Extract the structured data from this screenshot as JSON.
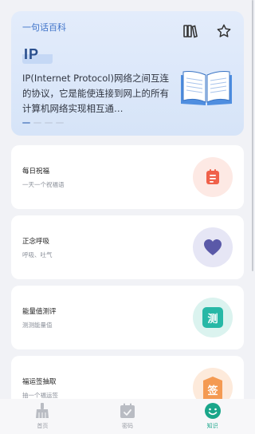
{
  "hero": {
    "subtitle": "一句话百科",
    "term": "IP",
    "description": "IP(Internet Protocol)网络之间互连的协议，它是能使连接到网上的所有计算机网络实现相互通…",
    "icons": [
      "bookshelf-icon",
      "star-icon"
    ]
  },
  "cards": [
    {
      "title": "每日祝福",
      "subtitle": "一天一个祝福语",
      "icon": "note-icon",
      "color": "#f0614a",
      "bg": "#fde9e4"
    },
    {
      "title": "正念呼吸",
      "subtitle": "呼吸、吐气",
      "icon": "heart-icon",
      "color": "#5a59a8",
      "bg": "#e6e6f5"
    },
    {
      "title": "能量值测评",
      "subtitle": "测测能量值",
      "icon_text": "测",
      "color": "#27b8a6",
      "bg": "#dbf3ef"
    },
    {
      "title": "福运签抽取",
      "subtitle": "抽一个福运签",
      "icon_text": "签",
      "color": "#f49a52",
      "bg": "#fdeadb"
    }
  ],
  "nav": [
    {
      "label": "首页",
      "icon": "broom-icon",
      "active": false
    },
    {
      "label": "密码",
      "icon": "calendar-check-icon",
      "active": false
    },
    {
      "label": "知识",
      "icon": "smile-icon",
      "active": true
    }
  ]
}
